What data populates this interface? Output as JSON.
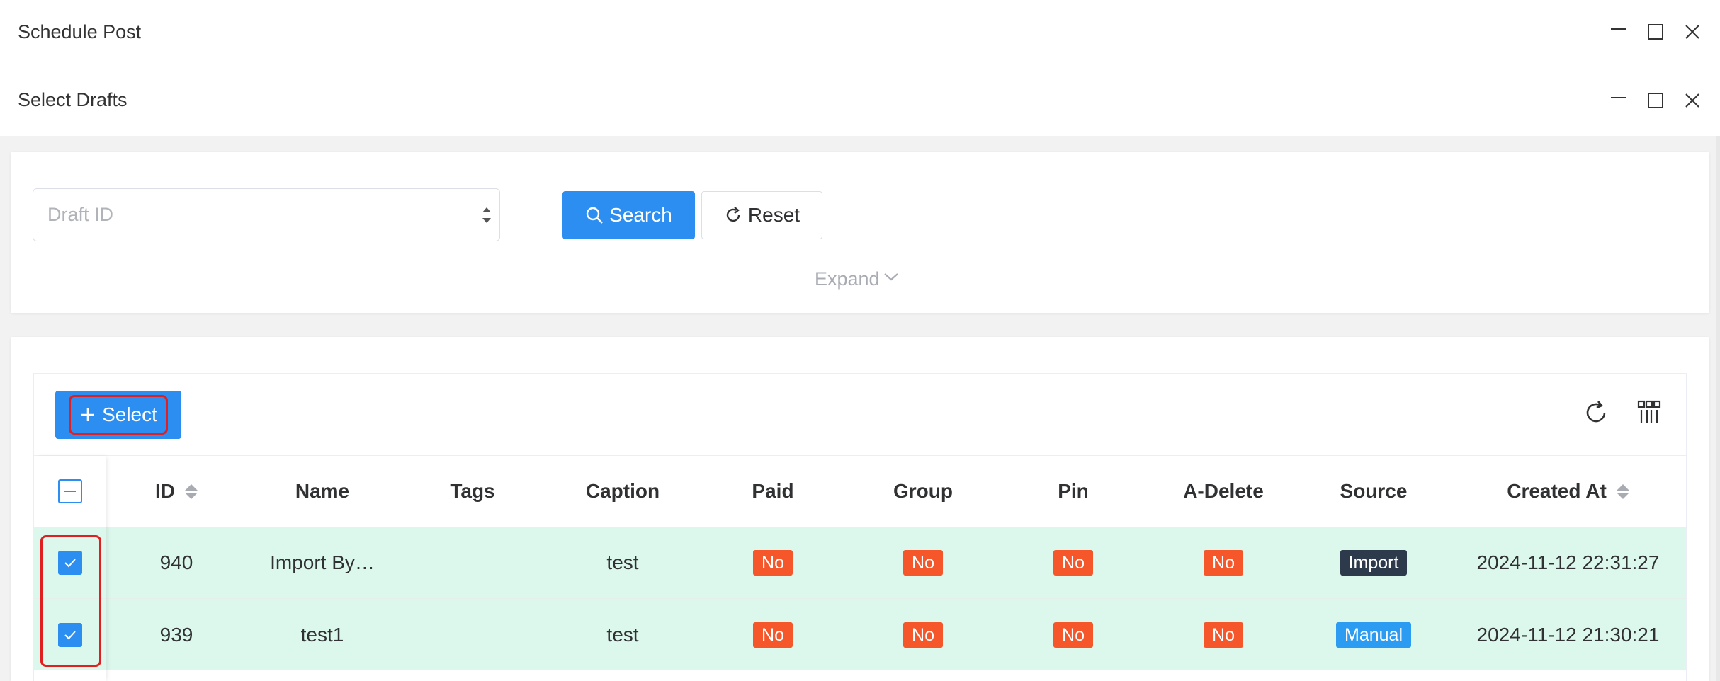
{
  "window1": {
    "title": "Schedule Post"
  },
  "window2": {
    "title": "Select Drafts"
  },
  "search": {
    "placeholder": "Draft ID",
    "value": "",
    "search_label": "Search",
    "reset_label": "Reset",
    "expand_label": "Expand"
  },
  "toolbar": {
    "select_label": "Select"
  },
  "table": {
    "columns": [
      "ID",
      "Name",
      "Tags",
      "Caption",
      "Paid",
      "Group",
      "Pin",
      "A-Delete",
      "Source",
      "Created At"
    ],
    "rows": [
      {
        "id": "940",
        "name": "Import By…",
        "tags": "",
        "caption": "test",
        "paid": "No",
        "group": "No",
        "pin": "No",
        "adelete": "No",
        "source": "Import",
        "created_at": "2024-11-12 22:31:27",
        "checked": true
      },
      {
        "id": "939",
        "name": "test1",
        "tags": "",
        "caption": "test",
        "paid": "No",
        "group": "No",
        "pin": "No",
        "adelete": "No",
        "source": "Manual",
        "created_at": "2024-11-12 21:30:21",
        "checked": true
      }
    ]
  },
  "colors": {
    "primary": "#2b8ef0",
    "tag_no": "#f5562a",
    "tag_import": "#2d3a4b",
    "tag_manual": "#2b9cf2",
    "row_selected": "#dcf8ec",
    "highlight": "#e02020"
  }
}
